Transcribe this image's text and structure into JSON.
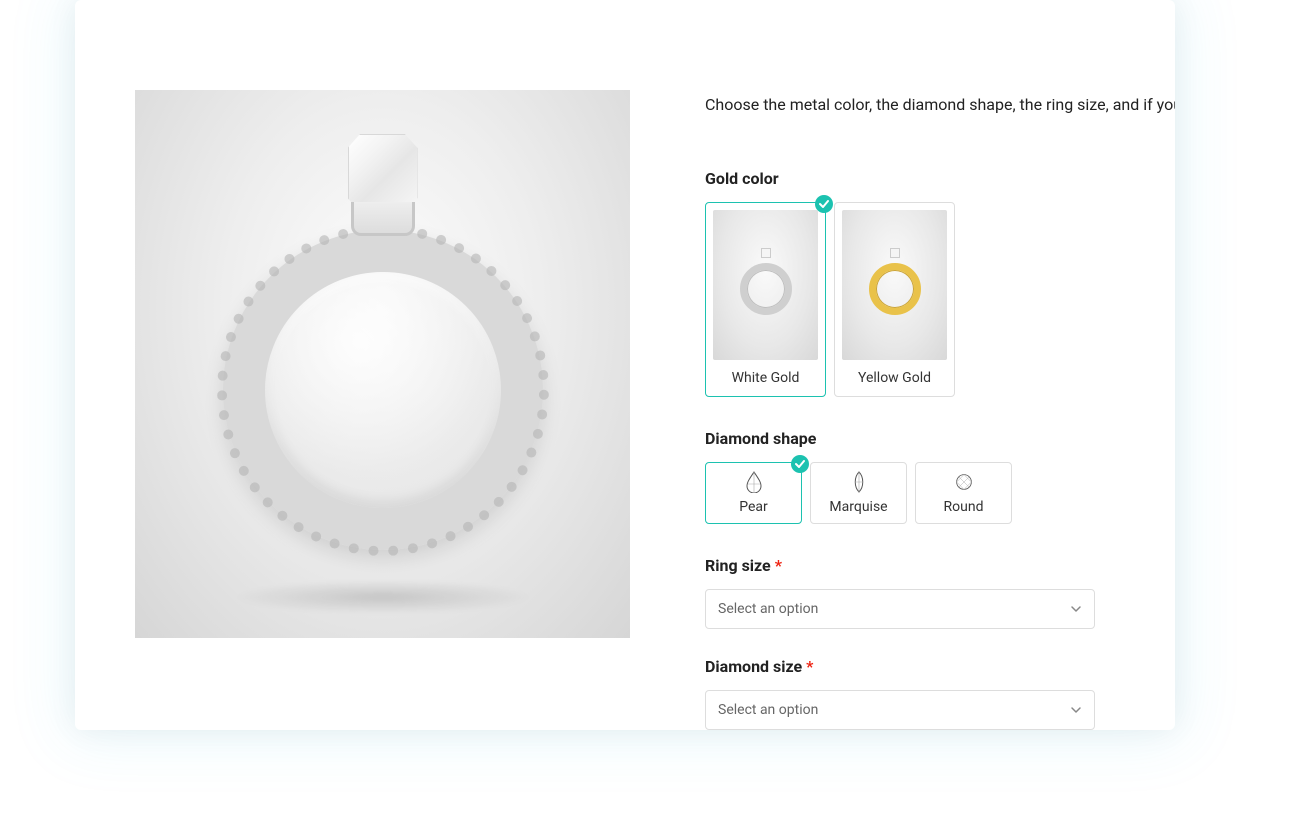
{
  "description": "Choose the metal color, the diamond shape, the ring size, and if you wa",
  "fields": {
    "gold_color": {
      "label": "Gold color",
      "options": [
        {
          "label": "White Gold",
          "selected": true
        },
        {
          "label": "Yellow Gold",
          "selected": false
        }
      ]
    },
    "diamond_shape": {
      "label": "Diamond shape",
      "options": [
        {
          "label": "Pear",
          "selected": true
        },
        {
          "label": "Marquise",
          "selected": false
        },
        {
          "label": "Round",
          "selected": false
        }
      ]
    },
    "ring_size": {
      "label": "Ring size",
      "required": true,
      "placeholder": "Select an option"
    },
    "diamond_size": {
      "label": "Diamond size",
      "required": true,
      "placeholder": "Select an option"
    }
  },
  "required_marker": "*"
}
